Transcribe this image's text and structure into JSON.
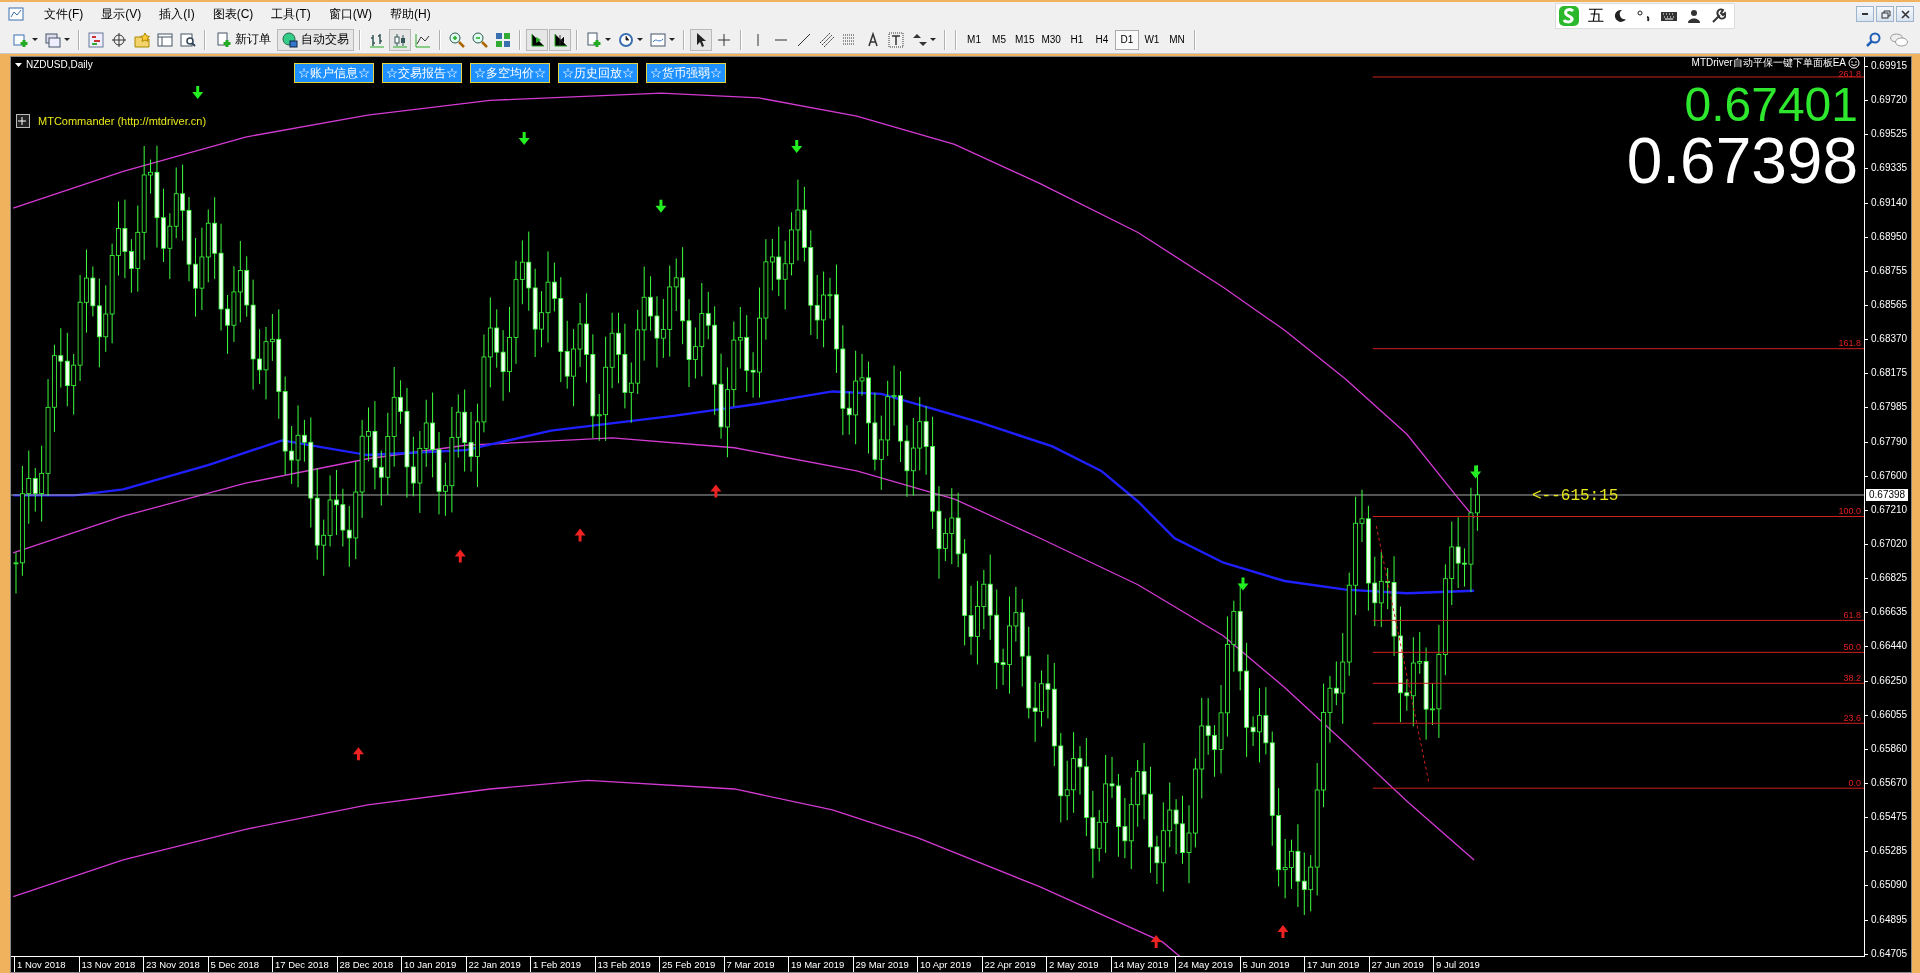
{
  "menu": [
    "文件(F)",
    "显示(V)",
    "插入(I)",
    "图表(C)",
    "工具(T)",
    "窗口(W)",
    "帮助(H)"
  ],
  "ime_bar": {
    "label": "五"
  },
  "toolbar": {
    "buttons": [
      "新订单",
      "自动交易"
    ]
  },
  "timeframes": [
    {
      "label": "M1",
      "selected": false
    },
    {
      "label": "M5",
      "selected": false
    },
    {
      "label": "M15",
      "selected": false
    },
    {
      "label": "M30",
      "selected": false
    },
    {
      "label": "H1",
      "selected": false
    },
    {
      "label": "H4",
      "selected": false
    },
    {
      "label": "D1",
      "selected": true
    },
    {
      "label": "W1",
      "selected": false
    },
    {
      "label": "MN",
      "selected": false
    }
  ],
  "chart": {
    "symbol": "NZDUSD,Daily",
    "panel_buttons": [
      "☆账户信息☆",
      "☆交易报告☆",
      "☆多空均价☆",
      "☆历史回放☆",
      "☆货币强弱☆"
    ],
    "indicator": "MTCommander (http://mtdriver.cn)",
    "ea_title": "MTDriver自动平保一键下单面板EA",
    "ask": "0.67401",
    "bid": "0.67398",
    "countdown": "<--615:15",
    "fib_levels": [
      "261.8",
      "161.8",
      "100.0",
      "61.8",
      "50.0",
      "38.2",
      "23.6",
      "0.0"
    ],
    "price_axis": [
      "0.69915",
      "0.69720",
      "0.69525",
      "0.69335",
      "0.69140",
      "0.68950",
      "0.68755",
      "0.68565",
      "0.68370",
      "0.68175",
      "0.67985",
      "0.67790",
      "0.67600",
      "0.67210",
      "0.67020",
      "0.66825",
      "0.66635",
      "0.66440",
      "0.66250",
      "0.66055",
      "0.65860",
      "0.65670",
      "0.65475",
      "0.65285",
      "0.65090",
      "0.64895",
      "0.64705"
    ],
    "current_price": "0.67398",
    "time_axis": [
      "1 Nov 2018",
      "13 Nov 2018",
      "23 Nov 2018",
      "5 Dec 2018",
      "17 Dec 2018",
      "28 Dec 2018",
      "10 Jan 2019",
      "22 Jan 2019",
      "1 Feb 2019",
      "13 Feb 2019",
      "25 Feb 2019",
      "7 Mar 2019",
      "19 Mar 2019",
      "29 Mar 2019",
      "10 Apr 2019",
      "22 Apr 2019",
      "2 May 2019",
      "14 May 2019",
      "24 May 2019",
      "5 Jun 2019",
      "17 Jun 2019",
      "27 Jun 2019",
      "9 Jul 2019"
    ]
  }
}
